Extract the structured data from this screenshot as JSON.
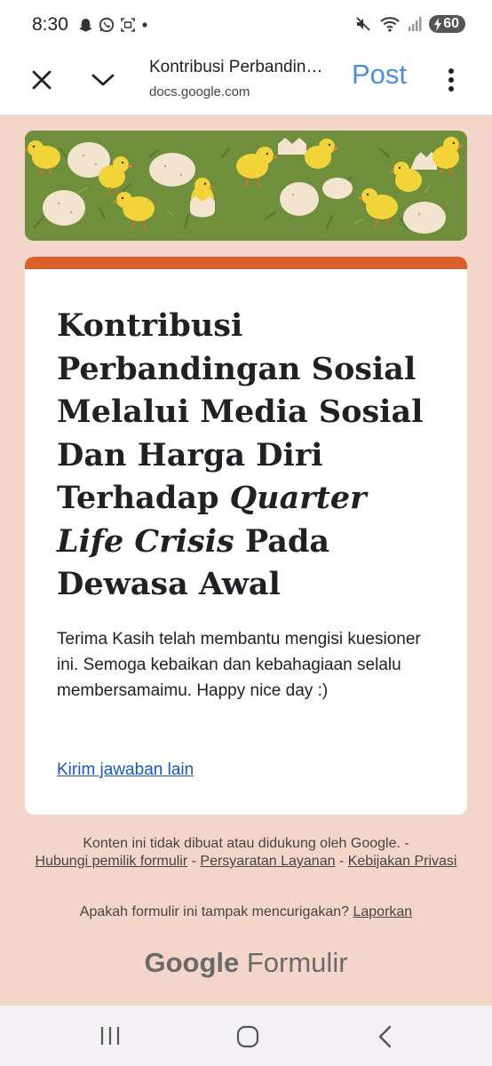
{
  "status_bar": {
    "time": "8:30",
    "battery": "60"
  },
  "toolbar": {
    "title": "Kontribusi Perbandingan Sosial Melalui Media Sosial",
    "url": "docs.google.com",
    "post_label": "Post"
  },
  "form": {
    "title_part1": "Kontribusi Perbandingan Sosial Melalui Media Sosial Dan Harga Diri Terhadap ",
    "title_italic": "Quarter Life Crisis",
    "title_part2": " Pada Dewasa Awal",
    "confirmation_message": "Terima Kasih telah membantu mengisi kuesioner ini. Semoga kebaikan dan kebahagiaan selalu membersamaimu. Happy nice day :)",
    "submit_another_link": "Kirim jawaban lain"
  },
  "footer": {
    "disclaimer": "Konten ini tidak dibuat atau didukung oleh Google. -",
    "link_contact": "Hubungi pemilik formulir",
    "sep1": " - ",
    "link_terms": "Persyaratan Layanan",
    "sep2": " - ",
    "link_privacy": "Kebijakan Privasi",
    "report_question": "Apakah formulir ini tampak mencurigakan? ",
    "report_link": "Laporkan",
    "logo_google": "Google",
    "logo_forms": " Formulir"
  },
  "colors": {
    "accent": "#d95f2b",
    "background": "#f3d6c9",
    "link": "#1a57b8",
    "post_button": "#4a90d9"
  }
}
